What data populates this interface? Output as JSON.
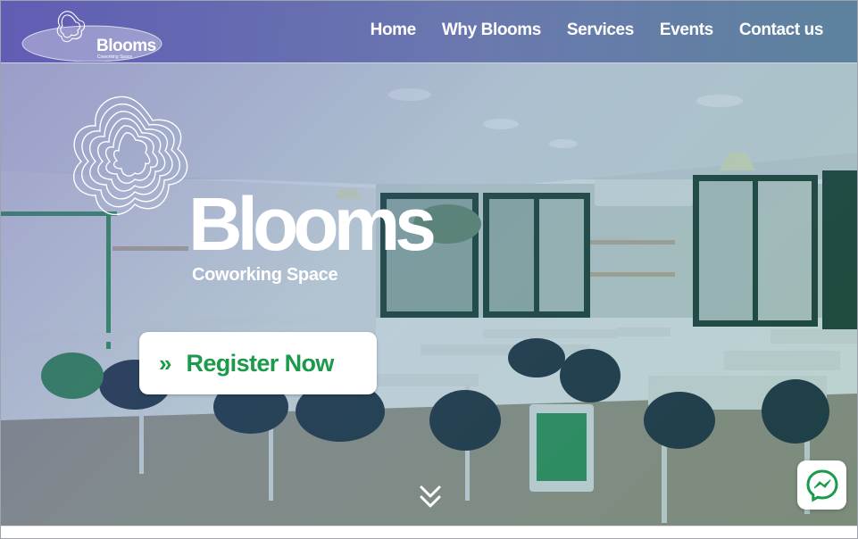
{
  "brand": {
    "logo_text": "Blooms",
    "logo_subtext": "Coworking Space",
    "hero_title": "Blooms",
    "hero_subtitle": "Coworking Space"
  },
  "nav": {
    "items": [
      {
        "label": "Home"
      },
      {
        "label": "Why Blooms"
      },
      {
        "label": "Services"
      },
      {
        "label": "Events"
      },
      {
        "label": "Contact us"
      }
    ]
  },
  "cta": {
    "label": "Register Now",
    "icon": "double-chevron-right-icon"
  },
  "widgets": {
    "scroll_icon": "double-chevron-down-icon",
    "chat_icon": "messenger-icon"
  },
  "colors": {
    "accent_green": "#1a9a4a",
    "nav_purple": "#5c58b2",
    "text_white": "#ffffff"
  }
}
